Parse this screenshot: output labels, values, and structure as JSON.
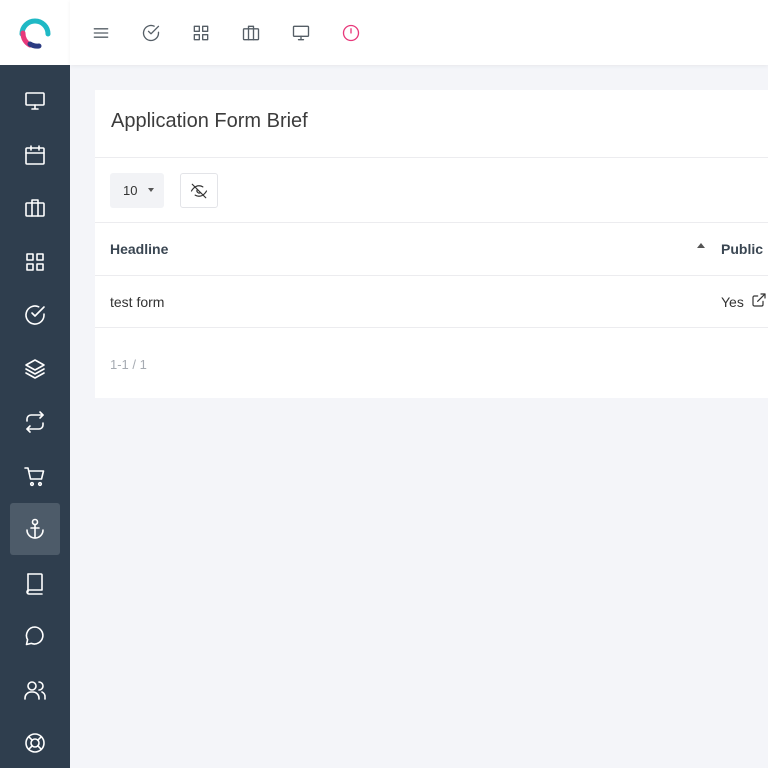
{
  "app": {
    "accent_color": "#e8397b",
    "sidebar_color": "#2f3e4e"
  },
  "topbar": {
    "icons": [
      "menu-icon",
      "check-circle-icon",
      "grid-icon",
      "briefcase-icon",
      "monitor-icon",
      "clock-icon"
    ]
  },
  "sidebar": {
    "items": [
      {
        "icon": "monitor-icon",
        "active": false
      },
      {
        "icon": "calendar-icon",
        "active": false
      },
      {
        "icon": "briefcase-icon",
        "active": false
      },
      {
        "icon": "grid-icon",
        "active": false
      },
      {
        "icon": "check-circle-icon",
        "active": false
      },
      {
        "icon": "layers-icon",
        "active": false
      },
      {
        "icon": "repeat-icon",
        "active": false
      },
      {
        "icon": "cart-icon",
        "active": false
      },
      {
        "icon": "anchor-icon",
        "active": true
      },
      {
        "icon": "book-icon",
        "active": false
      },
      {
        "icon": "chat-icon",
        "active": false
      },
      {
        "icon": "users-icon",
        "active": false
      },
      {
        "icon": "lifebuoy-icon",
        "active": false
      }
    ]
  },
  "card": {
    "title": "Application Form Brief",
    "per_page": "10",
    "columns": [
      "Headline",
      "Public"
    ],
    "rows": [
      {
        "headline": "test form",
        "public": "Yes"
      }
    ],
    "pagination": "1-1 / 1"
  }
}
